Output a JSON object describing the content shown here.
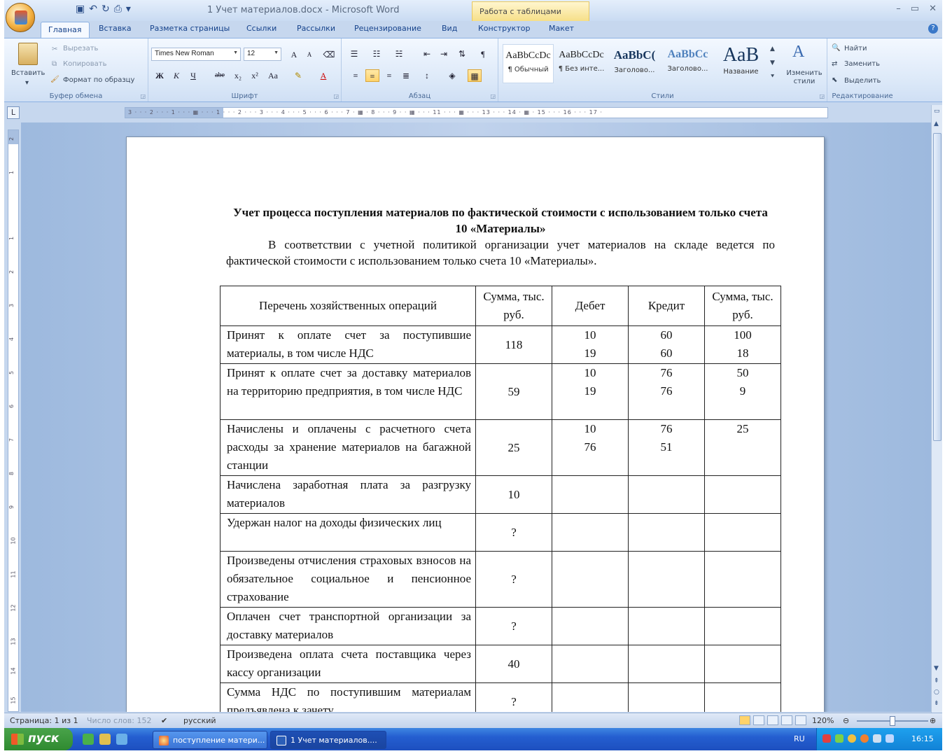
{
  "window": {
    "title": "1 Учет материалов.docx - Microsoft Word",
    "context_tab": "Работа с таблицами",
    "controls": [
      "–",
      "▭",
      "✕"
    ]
  },
  "tabs": [
    "Главная",
    "Вставка",
    "Разметка страницы",
    "Ссылки",
    "Рассылки",
    "Рецензирование",
    "Вид",
    "Конструктор",
    "Макет"
  ],
  "ribbon": {
    "clipboard": {
      "paste": "Вставить",
      "cut": "Вырезать",
      "copy": "Копировать",
      "format_painter": "Формат по образцу",
      "label": "Буфер обмена"
    },
    "font": {
      "name": "Times New Roman",
      "size": "12",
      "label": "Шрифт",
      "bold": "Ж",
      "italic": "К",
      "underline": "Ч",
      "strike": "abe",
      "subscript": "x₂",
      "superscript": "x²",
      "case": "Aa",
      "grow": "A",
      "shrink": "A"
    },
    "paragraph": {
      "label": "Абзац"
    },
    "styles": {
      "label": "Стили",
      "items": [
        {
          "sample": "AaBbCcDc",
          "name": "¶ Обычный"
        },
        {
          "sample": "AaBbCcDc",
          "name": "¶ Без инте..."
        },
        {
          "sample": "AaBbC(",
          "name": "Заголово..."
        },
        {
          "sample": "AaBbCc",
          "name": "Заголово..."
        },
        {
          "sample": "AaB",
          "name": "Название"
        }
      ],
      "change_styles": "Изменить стили"
    },
    "editing": {
      "label": "Редактирование",
      "find": "Найти",
      "replace": "Заменить",
      "select": "Выделить"
    }
  },
  "ruler": {
    "horizontal": "3 · · · 2 · · · 1 · · · ▦ · · · 1 · · · 2 · · · 3 · · · 4 · · · 5 · · · 6 · · · 7 · ▦ · 8 · · · 9 · · ▦ · · · 11 · · · ▦ · · · 13 · · · 14 · ▦ · 15 · · · 16 · · · 17 ·",
    "vertical_numbers": [
      "2",
      "1",
      "1",
      "2",
      "3",
      "4",
      "5",
      "6",
      "7",
      "8",
      "9",
      "10",
      "11",
      "12",
      "13",
      "14",
      "15"
    ]
  },
  "document": {
    "heading": "Учет процесса поступления материалов по фактической стоимости с использованием только счета 10 «Материалы»",
    "paragraph": "В соответствии с учетной политикой организации учет материалов на складе ведется по фактической стоимости с использованием только счета 10 «Материалы».",
    "table": {
      "headers": [
        "Перечень хозяйственных операций",
        "Сумма, тыс. руб.",
        "Дебет",
        "Кредит",
        "Сумма, тыс. руб."
      ],
      "rows": [
        {
          "op": "Принят к оплате счет за поступившие материалы, в том числе НДС",
          "sum": "118",
          "debit": [
            "10",
            "19"
          ],
          "credit": [
            "60",
            "60"
          ],
          "amount": [
            "100",
            "18"
          ]
        },
        {
          "op": "Принят к оплате счет за доставку материалов на территорию предприятия, в том числе НДС",
          "sum": "59",
          "debit": [
            "10",
            "19"
          ],
          "credit": [
            "76",
            "76"
          ],
          "amount": [
            "50",
            "9"
          ]
        },
        {
          "op": "Начислены и оплачены с расчетного счета расходы за хранение материалов на багажной станции",
          "sum": "25",
          "debit": [
            "10",
            "76"
          ],
          "credit": [
            "76",
            "51"
          ],
          "amount": [
            "25"
          ]
        },
        {
          "op": "Начислена заработная плата за разгрузку материалов",
          "sum": "10",
          "debit": [],
          "credit": [],
          "amount": []
        },
        {
          "op": "Удержан налог на доходы физических лиц",
          "sum": "?",
          "debit": [],
          "credit": [],
          "amount": []
        },
        {
          "op": "Произведены отчисления страховых взносов на обязательное социальное и пенсионное страхование",
          "sum": "?",
          "debit": [],
          "credit": [],
          "amount": []
        },
        {
          "op": "Оплачен счет транспортной организации за доставку материалов",
          "sum": "?",
          "debit": [],
          "credit": [],
          "amount": []
        },
        {
          "op": "Произведена оплата счета поставщика через кассу организации",
          "sum": "40",
          "debit": [],
          "credit": [],
          "amount": []
        },
        {
          "op": "Сумма НДС по поступившим материалам предъявлена к зачету",
          "sum": "?",
          "debit": [],
          "credit": [],
          "amount": []
        }
      ]
    }
  },
  "statusbar": {
    "page": "Страница: 1 из 1",
    "words": "Число слов: 152",
    "language": "русский",
    "zoom": "120%",
    "zoom_level": 0.5
  },
  "taskbar": {
    "start": "пуск",
    "tasks": [
      "поступление матери...",
      "1 Учет материалов...."
    ],
    "lang": "RU",
    "time": "16:15"
  },
  "colors": {
    "accent": "#15428b",
    "ribbon": "#dbe8f8",
    "taskbar": "#245ed0",
    "start": "#3a9a3b"
  }
}
